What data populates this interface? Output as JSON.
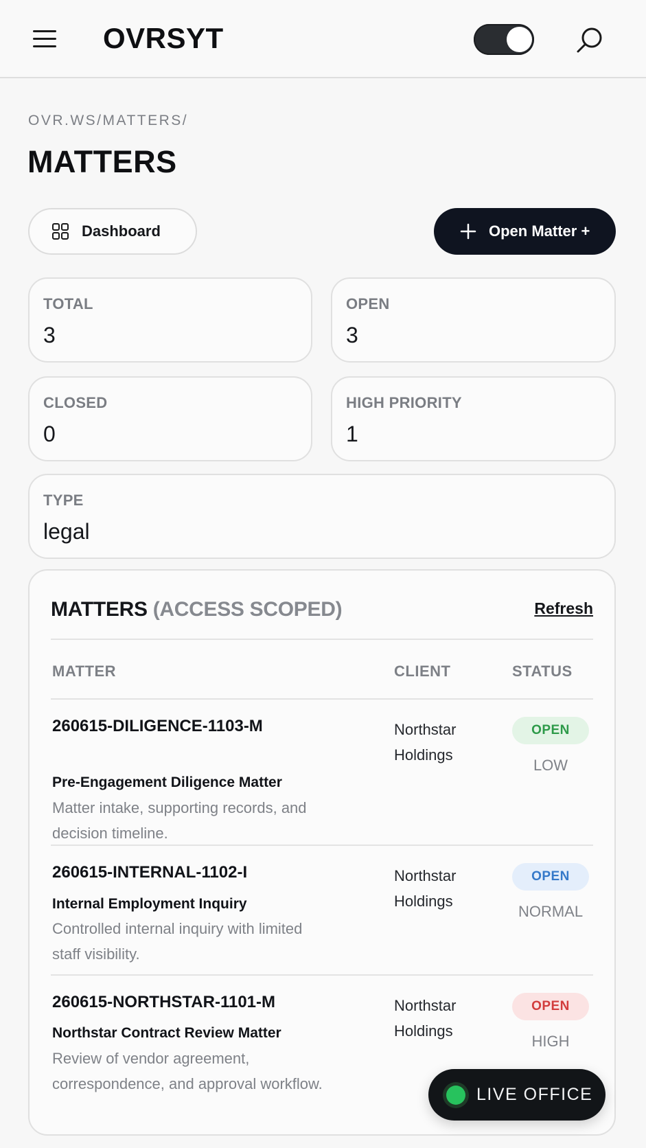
{
  "app": {
    "logo": "OVRSYT"
  },
  "breadcrumb": "OVR.WS/MATTERS/",
  "page_title": "MATTERS",
  "actions": {
    "dashboard_label": "Dashboard",
    "open_matter_label": "Open Matter +"
  },
  "stats": [
    {
      "label": "TOTAL",
      "value": "3"
    },
    {
      "label": "OPEN",
      "value": "3"
    },
    {
      "label": "CLOSED",
      "value": "0"
    },
    {
      "label": "HIGH PRIORITY",
      "value": "1"
    },
    {
      "label": "TYPE",
      "value": "legal"
    }
  ],
  "panel": {
    "title": "MATTERS",
    "scope": "(ACCESS SCOPED)",
    "refresh_label": "Refresh",
    "columns": [
      "MATTER",
      "CLIENT",
      "STATUS"
    ],
    "rows": [
      {
        "id": "260615-DILIGENCE-1103-M",
        "title": "Pre-Engagement Diligence Matter",
        "description": "Matter intake, supporting records, and decision timeline.",
        "client": "Northstar Holdings",
        "status": "OPEN",
        "priority": "LOW",
        "status_color": "#2d9a49"
      },
      {
        "id": "260615-INTERNAL-1102-I",
        "title": "Internal Employment Inquiry",
        "description": "Controlled internal inquiry with limited staff visibility.",
        "client": "Northstar Holdings",
        "status": "OPEN",
        "priority": "NORMAL",
        "status_color": "#3579c9"
      },
      {
        "id": "260615-NORTHSTAR-1101-M",
        "title": "Northstar Contract Review Matter",
        "description": "Review of vendor agreement, correspondence, and approval workflow.",
        "client": "Northstar Holdings",
        "status": "OPEN",
        "priority": "HIGH",
        "status_color": "#d23c3c"
      }
    ]
  },
  "live_office": {
    "label": "LIVE OFFICE",
    "indicator_color": "#27c25d"
  },
  "icons": [
    "menu-icon",
    "theme-toggle",
    "search-icon",
    "grid-icon",
    "plus-icon",
    "live-dot-icon"
  ]
}
